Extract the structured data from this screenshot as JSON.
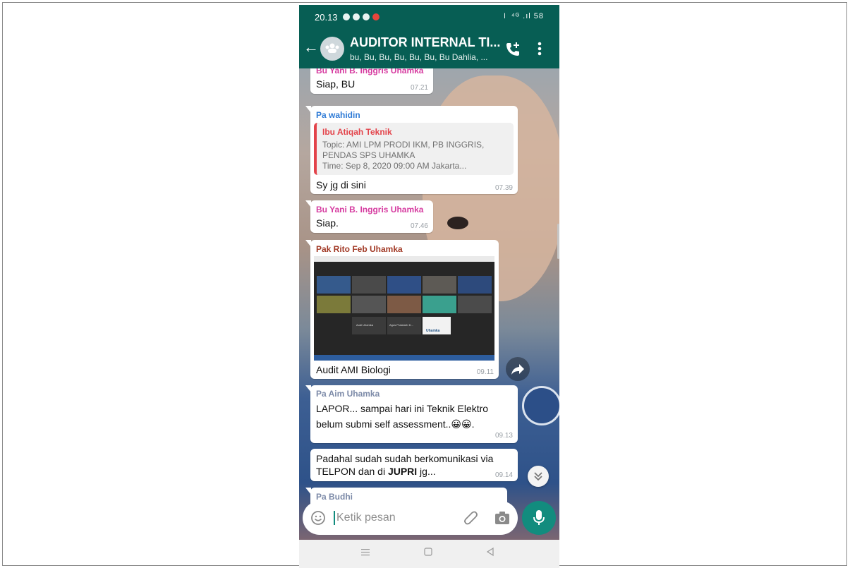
{
  "status": {
    "time": "20.13",
    "right": "⏽ ⁴ᴳ .ıl 58"
  },
  "header": {
    "title": "AUDITOR INTERNAL TI...",
    "subtitle": "bu, Bu, Bu, Bu, Bu, Bu, Bu Dahlia, ..."
  },
  "messages": [
    {
      "sender": "Bu Yani B. Inggris Uhamka",
      "sender_color": "#d63ca0",
      "text": "Siap, BU",
      "time": "07.21"
    },
    {
      "sender": "Pa wahidin",
      "sender_color": "#2f7bd6",
      "quote": {
        "name": "Ibu Atiqah Teknik",
        "line1": "Topic: AMI LPM PRODI IKM, PB INGGRIS,",
        "line2": "PENDAS SPS UHAMKA",
        "line3": "Time: Sep 8, 2020 09:00 AM Jakarta..."
      },
      "text": "Sy jg di sini",
      "time": "07.39"
    },
    {
      "sender": "Bu Yani B. Inggris Uhamka",
      "sender_color": "#d63ca0",
      "text": "Siap.",
      "time": "07.46"
    },
    {
      "sender": "Pak Rito Feb Uhamka",
      "sender_color": "#a23a26",
      "caption": "Audit AMI Biologi",
      "time": "09.11"
    },
    {
      "sender": "Pa Aim Uhamka",
      "sender_color": "#7c8aa8",
      "line1": "LAPOR... sampai hari ini Teknik Elektro",
      "line2": "belum submi self assessment..",
      "emoji": "😀😀.",
      "time": "09.13"
    },
    {
      "line1": "Padahal sudah sudah berkomunikasi via",
      "line2_pre": "TELPON dan di ",
      "line2_bold": "JUPRI",
      "line2_post": " jg...",
      "time": "09.14"
    },
    {
      "sender": "Pa Budhi",
      "sender_color": "#7c8aa8"
    }
  ],
  "image_labels": {
    "tile1": "Audi Uhamka",
    "tile2": "Agus Prasbarb D...",
    "logo": "Uhamka"
  },
  "input": {
    "placeholder": "Ketik pesan"
  },
  "icons": {
    "back": "back-arrow-icon",
    "call": "add-call-icon",
    "more": "more-vert-icon",
    "emoji": "emoji-icon",
    "attach": "attach-icon",
    "camera": "camera-icon",
    "mic": "mic-icon",
    "forward": "forward-icon",
    "scroll": "chevron-double-down-icon"
  },
  "colors": {
    "primary": "#075e54",
    "accent": "#128c7e"
  }
}
